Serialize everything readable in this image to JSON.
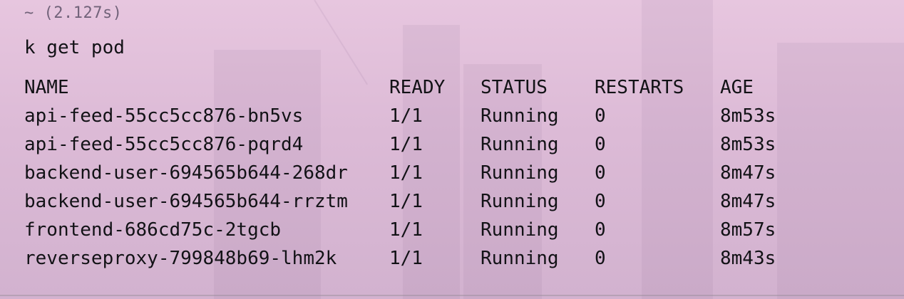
{
  "terminal": {
    "previous_timing": "~ (2.127s)",
    "command": "k get pod"
  },
  "pods": {
    "columns": [
      "NAME",
      "READY",
      "STATUS",
      "RESTARTS",
      "AGE"
    ],
    "rows": [
      [
        "api-feed-55cc5cc876-bn5vs",
        "1/1",
        "Running",
        "0",
        "8m53s"
      ],
      [
        "api-feed-55cc5cc876-pqrd4",
        "1/1",
        "Running",
        "0",
        "8m53s"
      ],
      [
        "backend-user-694565b644-268dr",
        "1/1",
        "Running",
        "0",
        "8m47s"
      ],
      [
        "backend-user-694565b644-rrztm",
        "1/1",
        "Running",
        "0",
        "8m47s"
      ],
      [
        "frontend-686cd75c-2tgcb",
        "1/1",
        "Running",
        "0",
        "8m57s"
      ],
      [
        "reverseproxy-799848b69-lhm2k",
        "1/1",
        "Running",
        "0",
        "8m43s"
      ]
    ]
  }
}
